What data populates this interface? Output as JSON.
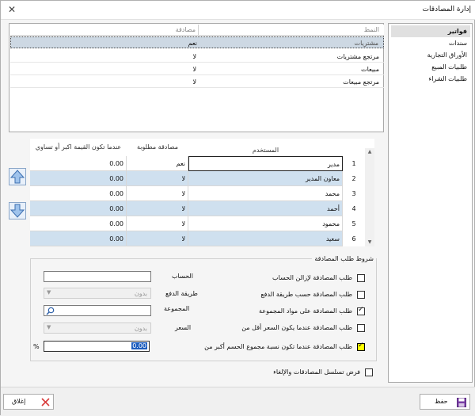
{
  "window": {
    "title": "إدارة المصادقات",
    "close_glyph": "✕"
  },
  "categories": [
    {
      "label": "فواتير",
      "selected": true
    },
    {
      "label": "سندات",
      "selected": false
    },
    {
      "label": "الأوراق التجارية",
      "selected": false
    },
    {
      "label": "طلبيات المبيع",
      "selected": false
    },
    {
      "label": "طلبيات الشراء",
      "selected": false
    }
  ],
  "top_table": {
    "headers": {
      "pattern": "النمط",
      "approval": "مصادقة"
    },
    "rows": [
      {
        "pattern": "مشتريات",
        "approval": "نعم",
        "selected": true
      },
      {
        "pattern": "مرتجع مشتريات",
        "approval": "لا",
        "selected": false
      },
      {
        "pattern": "مبيعات",
        "approval": "لا",
        "selected": false
      },
      {
        "pattern": "مرتجع مبيعات",
        "approval": "لا",
        "selected": false
      }
    ]
  },
  "users_grid": {
    "headers": {
      "user": "المستخدم",
      "required": "مصادقة مطلوبة",
      "value_condition": "عندما تكون القيمة اكبر أو تساوي"
    },
    "rows": [
      {
        "num": "1",
        "user": "مدير",
        "required": "نعم",
        "value": "0.00"
      },
      {
        "num": "2",
        "user": "معاون المدير",
        "required": "لا",
        "value": "0.00"
      },
      {
        "num": "3",
        "user": "محمد",
        "required": "لا",
        "value": "0.00"
      },
      {
        "num": "4",
        "user": "أحمد",
        "required": "لا",
        "value": "0.00"
      },
      {
        "num": "5",
        "user": "محمود",
        "required": "لا",
        "value": "0.00"
      },
      {
        "num": "6",
        "user": "سعيد",
        "required": "لا",
        "value": "0.00"
      }
    ]
  },
  "conditions": {
    "legend": "شروط طلب المصادقة",
    "items": [
      {
        "label": "طلب المصادقة لإزالن الحساب",
        "checked": false
      },
      {
        "label": "طلب المصادقة حسب طريقة الدفع",
        "checked": false
      },
      {
        "label": "طلب المصادقة على مواد المجموعة",
        "checked": true
      },
      {
        "label": "طلب المصادقة عندما يكون السعر أقل من",
        "checked": false
      },
      {
        "label": "طلب المصادقة عندما تكون نسبة مجموع الحسم أكبر من",
        "checked": true
      }
    ],
    "account_label": "الحساب",
    "payment_label": "طريقة الدفع",
    "payment_value": "بدون",
    "group_label": "المجموعة",
    "price_label": "السعر",
    "price_value": "بدون",
    "percent_value": "0.00",
    "percent_sign": "%"
  },
  "enforce": {
    "label": "فرض تسلسل المصادقات والإلغاء",
    "checked": false
  },
  "buttons": {
    "save": "حفظ",
    "close": "إغلاق"
  }
}
